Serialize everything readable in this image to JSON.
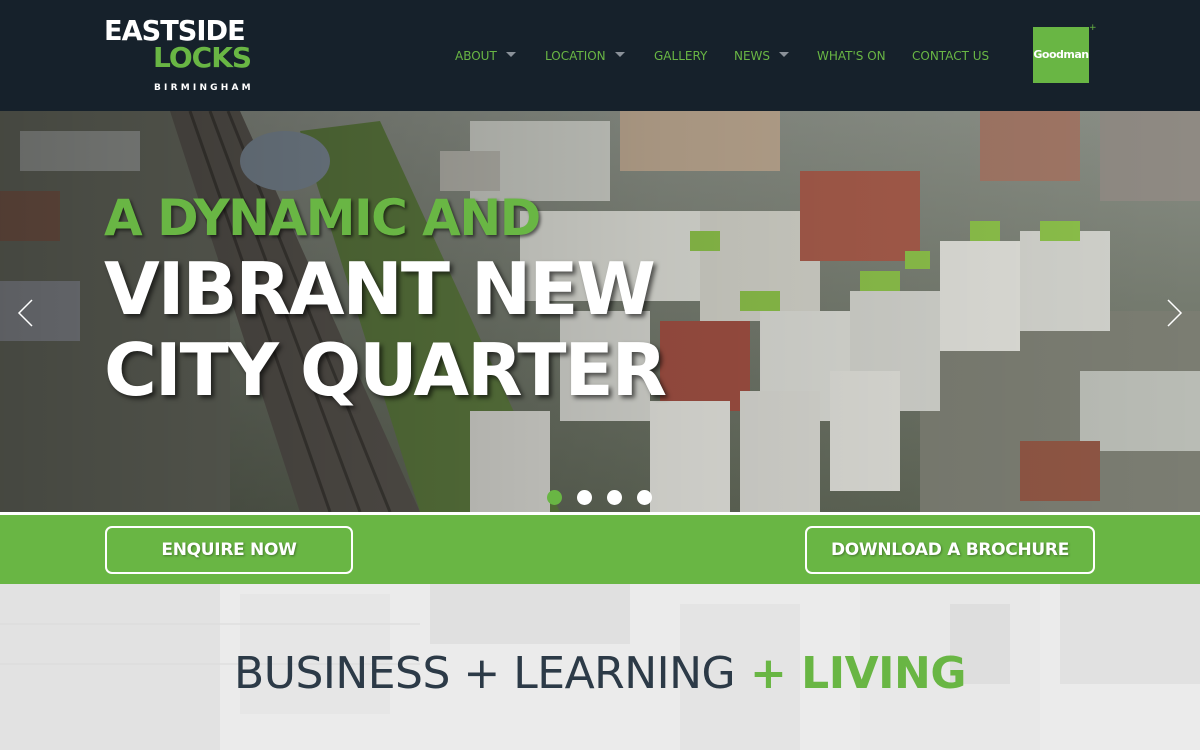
{
  "brand": {
    "logo_line1": "EASTSIDE",
    "logo_line2": "LOCKS",
    "logo_line3": "BIRMINGHAM",
    "partner_logo": "Goodman",
    "partner_logo_mark": "+",
    "colors": {
      "green": "#69b644",
      "navy": "#16212b",
      "heading": "#2c3a47"
    }
  },
  "nav": {
    "items": [
      {
        "label": "ABOUT",
        "has_dropdown": true
      },
      {
        "label": "LOCATION",
        "has_dropdown": true
      },
      {
        "label": "GALLERY",
        "has_dropdown": false
      },
      {
        "label": "NEWS",
        "has_dropdown": true
      },
      {
        "label": "WHAT'S ON",
        "has_dropdown": false
      },
      {
        "label": "CONTACT US",
        "has_dropdown": false
      }
    ]
  },
  "hero": {
    "title_line1": "A DYNAMIC AND",
    "title_line2": "VIBRANT NEW",
    "title_line3": "CITY QUARTER",
    "prev_icon": "chevron-left-icon",
    "next_icon": "chevron-right-icon",
    "slide_count": 4,
    "active_slide": 1
  },
  "cta": {
    "enquire_label": "ENQUIRE NOW",
    "brochure_label": "DOWNLOAD A BROCHURE"
  },
  "section": {
    "heading_part1": "BUSINESS + LEARNING",
    "heading_part2": " + LIVING"
  }
}
